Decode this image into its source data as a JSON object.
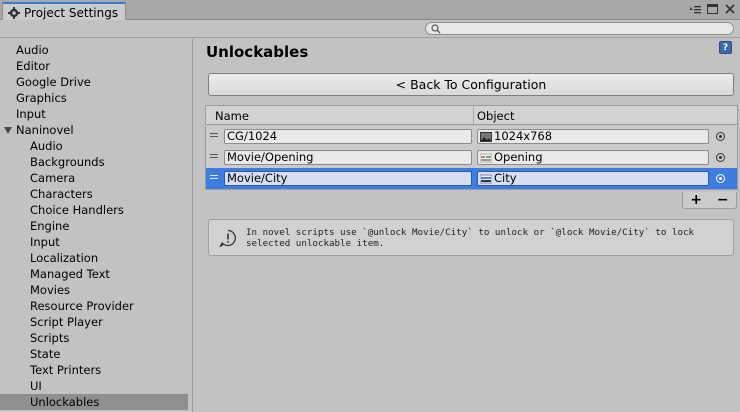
{
  "window": {
    "tab_title": "Project Settings",
    "tab_icon": "gear-icon",
    "menu_icon": "window-menu-icon",
    "maximize_icon": "maximize-icon",
    "close_icon": "close-icon"
  },
  "search": {
    "placeholder": "",
    "value": ""
  },
  "sidebar": {
    "items": [
      {
        "label": "Audio",
        "indent": 0
      },
      {
        "label": "Editor",
        "indent": 0
      },
      {
        "label": "Google Drive",
        "indent": 0
      },
      {
        "label": "Graphics",
        "indent": 0
      },
      {
        "label": "Input",
        "indent": 0
      },
      {
        "label": "Naninovel",
        "indent": 0,
        "expanded": true
      },
      {
        "label": "Audio",
        "indent": 1
      },
      {
        "label": "Backgrounds",
        "indent": 1
      },
      {
        "label": "Camera",
        "indent": 1
      },
      {
        "label": "Characters",
        "indent": 1
      },
      {
        "label": "Choice Handlers",
        "indent": 1
      },
      {
        "label": "Engine",
        "indent": 1
      },
      {
        "label": "Input",
        "indent": 1
      },
      {
        "label": "Localization",
        "indent": 1
      },
      {
        "label": "Managed Text",
        "indent": 1
      },
      {
        "label": "Movies",
        "indent": 1
      },
      {
        "label": "Resource Provider",
        "indent": 1
      },
      {
        "label": "Script Player",
        "indent": 1
      },
      {
        "label": "Scripts",
        "indent": 1
      },
      {
        "label": "State",
        "indent": 1
      },
      {
        "label": "Text Printers",
        "indent": 1
      },
      {
        "label": "UI",
        "indent": 1
      },
      {
        "label": "Unlockables",
        "indent": 1,
        "selected": true
      }
    ]
  },
  "main": {
    "title": "Unlockables",
    "back_button": "< Back To Configuration",
    "columns": {
      "name": "Name",
      "object": "Object"
    },
    "rows": [
      {
        "name": "CG/1024",
        "object": "1024x768",
        "object_icon": "image-texture-icon",
        "selected": false
      },
      {
        "name": "Movie/Opening",
        "object": "Opening",
        "object_icon": "video-clip-icon",
        "selected": false
      },
      {
        "name": "Movie/City",
        "object": "City",
        "object_icon": "video-clip-icon",
        "selected": true
      }
    ],
    "add_label": "+",
    "remove_label": "−",
    "info_text": "In novel scripts use `@unlock Movie/City` to unlock or `@lock Movie/City` to lock selected unlockable item."
  },
  "colors": {
    "selection_blue": "#3e7de0",
    "sidebar_selected": "#8f8f8f",
    "background": "#c2c2c2",
    "tab_accent": "#3a7bd5"
  }
}
